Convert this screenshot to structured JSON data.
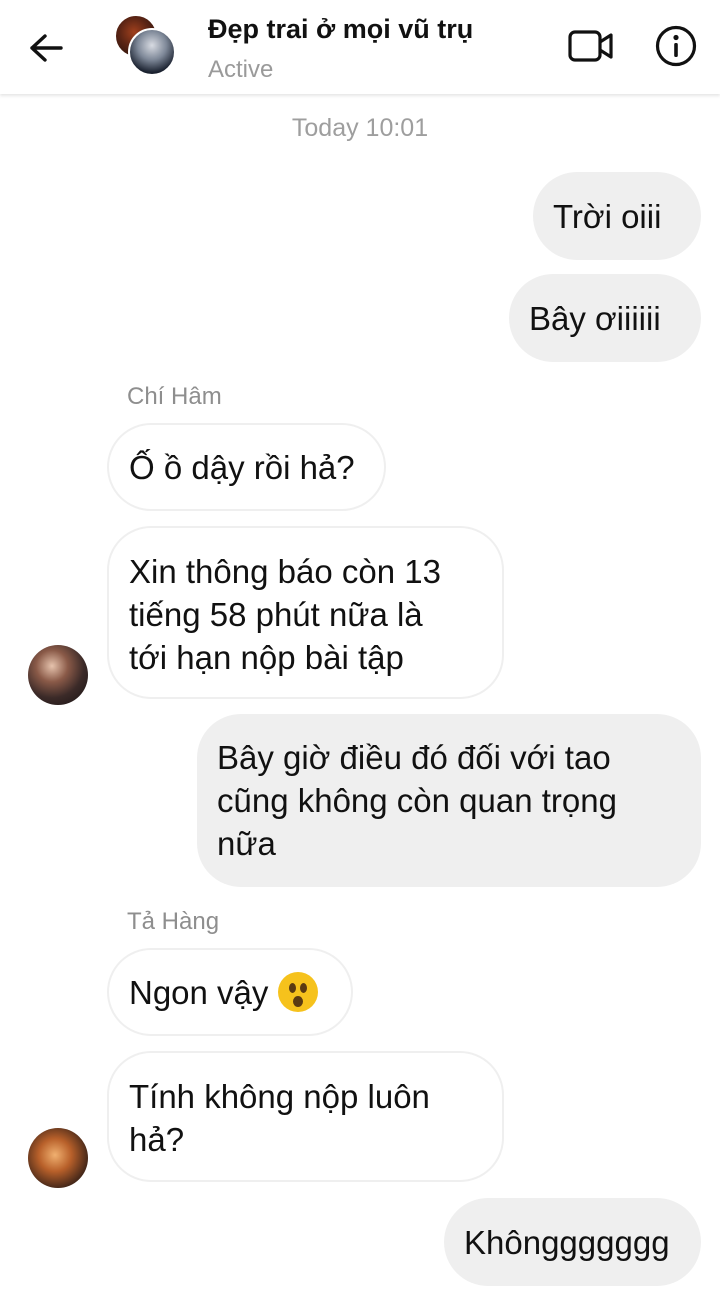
{
  "header": {
    "title": "Đẹp trai ở mọi vũ trụ",
    "status": "Active"
  },
  "thread": {
    "timestamp": "Today 10:01",
    "messages": [
      {
        "side": "out",
        "text": "Trời oiii"
      },
      {
        "side": "out",
        "text": "Bây ơiiiiii"
      },
      {
        "side": "in",
        "sender": "Chí Hâm",
        "text": "Ố ồ dậy rồi hả?"
      },
      {
        "side": "in",
        "text_lines": [
          "Xin thông báo còn 13",
          "tiếng 58 phút nữa là",
          "tới hạn nộp bài tập"
        ]
      },
      {
        "side": "out",
        "text_lines": [
          "Bây giờ điều đó đối với tao",
          "cũng không còn quan trọng",
          "nữa"
        ]
      },
      {
        "side": "in",
        "sender": "Tả Hàng",
        "text": "Ngon vậy",
        "emoji": "astonished-face"
      },
      {
        "side": "in",
        "text_lines": [
          "Tính không nộp luôn",
          "hả?"
        ]
      },
      {
        "side": "out",
        "text": "Khônggggggg"
      }
    ]
  },
  "colors": {
    "outgoing_bubble": "#efefef",
    "incoming_border": "#efefef",
    "meta_text": "#9e9e9e"
  }
}
